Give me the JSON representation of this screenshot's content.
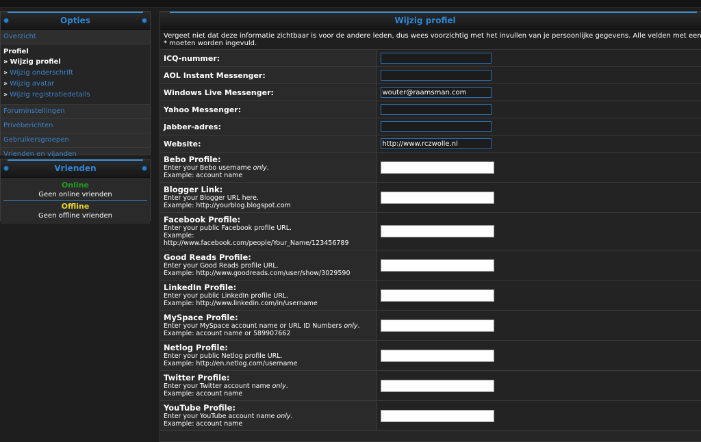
{
  "options_panel": {
    "title": "Opties",
    "overview": "Overzicht",
    "profile_group": {
      "title": "Profiel",
      "items": [
        {
          "label": "Wijzig profiel"
        },
        {
          "label": "Wijzig onderschrift"
        },
        {
          "label": "Wijzig avatar"
        },
        {
          "label": "Wijzig registratiedetails"
        }
      ]
    },
    "links": [
      {
        "label": "Foruminstellingen"
      },
      {
        "label": "Privéberichten"
      },
      {
        "label": "Gebruikersgroepen"
      },
      {
        "label": "Vrienden en vijanden"
      }
    ],
    "arrow": "»"
  },
  "friends_panel": {
    "title": "Vrienden",
    "online_label": "Online",
    "online_msg": "Geen online vrienden",
    "offline_label": "Offline",
    "offline_msg": "Geen offline vrienden"
  },
  "main": {
    "title": "Wijzig profiel",
    "intro": "Vergeet niet dat deze informatie zichtbaar is voor de andere leden, dus wees voorzichtig met het invullen van je persoonlijke gegevens. Alle velden met een * moeten worden ingevuld.",
    "fields": [
      {
        "label": "ICQ-nummer:",
        "value": ""
      },
      {
        "label": "AOL Instant Messenger:",
        "value": ""
      },
      {
        "label": "Windows Live Messenger:",
        "value": "wouter@raamsman.com"
      },
      {
        "label": "Yahoo Messenger:",
        "value": ""
      },
      {
        "label": "Jabber-adres:",
        "value": ""
      },
      {
        "label": "Website:",
        "value": "http://www.rczwolle.nl"
      }
    ],
    "profiles": [
      {
        "title": "Bebo Profile:",
        "desc1": "Enter your Bebo username ",
        "desc_em": "only",
        "desc1_end": ".",
        "example": "Example: account name",
        "value": ""
      },
      {
        "title": "Blogger Link:",
        "desc1": "Enter your Blogger URL here.",
        "desc_em": "",
        "desc1_end": "",
        "example": "Example: http://yourblog.blogspot.com",
        "value": ""
      },
      {
        "title": "Facebook Profile:",
        "desc1": "Enter your public Facebook profile URL.",
        "desc_em": "",
        "desc1_end": "",
        "example": "Example: http://www.facebook.com/people/Your_Name/123456789",
        "value": ""
      },
      {
        "title": "Good Reads Profile:",
        "desc1": "Enter your Good Reads profile URL.",
        "desc_em": "",
        "desc1_end": "",
        "example": "Example: http://www.goodreads.com/user/show/3029590",
        "value": ""
      },
      {
        "title": "LinkedIn Profile:",
        "desc1": "Enter your public LinkedIn profile URL.",
        "desc_em": "",
        "desc1_end": "",
        "example": "Example: http://www.linkedin.com/in/username",
        "value": ""
      },
      {
        "title": "MySpace Profile:",
        "desc1": "Enter your MySpace account name or URL ID Numbers ",
        "desc_em": "only",
        "desc1_end": ".",
        "example": "Example: account name or 589907662",
        "value": ""
      },
      {
        "title": "Netlog Profile:",
        "desc1": "Enter your public Netlog profile URL.",
        "desc_em": "",
        "desc1_end": "",
        "example": "Example: http://en.netlog.com/username",
        "value": ""
      },
      {
        "title": "Twitter Profile:",
        "desc1": "Enter your Twitter account name ",
        "desc_em": "only",
        "desc1_end": ".",
        "example": "Example: account name",
        "value": ""
      },
      {
        "title": "YouTube Profile:",
        "desc1": "Enter your YouTube account name ",
        "desc_em": "only",
        "desc1_end": ".",
        "example": "Example: account name",
        "value": ""
      }
    ]
  },
  "colors": {
    "accent": "#3a8fd8",
    "link": "#3d83c9",
    "online": "#1e9e1e",
    "offline": "#e8d22a"
  }
}
